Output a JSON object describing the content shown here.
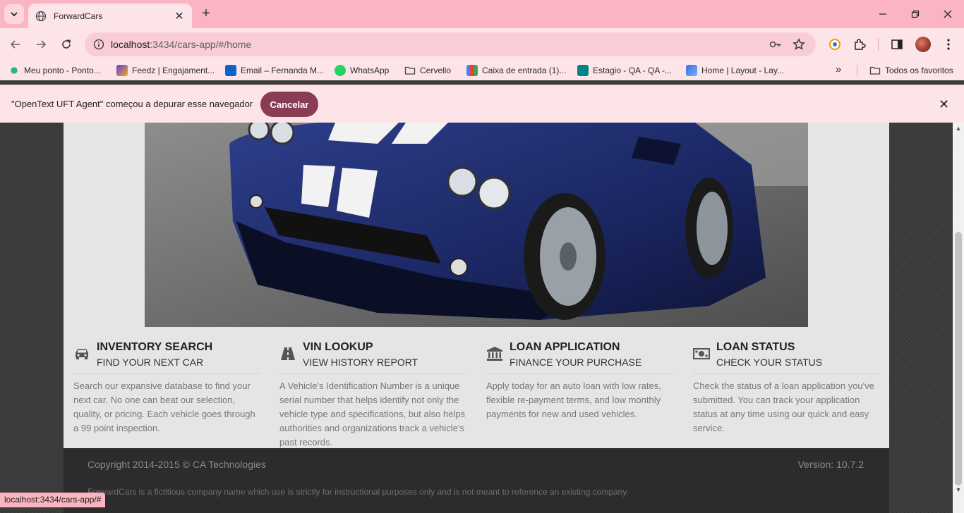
{
  "browser": {
    "tab_title": "ForwardCars",
    "url_host": "localhost",
    "url_path": ":3434/cars-app/#/home",
    "bookmarks": [
      {
        "label": "Meu ponto - Ponto...",
        "icon": "green-burst-icon",
        "color": "#2bb673"
      },
      {
        "label": "Feedz | Engajament...",
        "icon": "feedz-icon",
        "color": "#5b3fd6"
      },
      {
        "label": "Email – Fernanda M...",
        "icon": "outlook-icon",
        "color": "#0a64c9"
      },
      {
        "label": "WhatsApp",
        "icon": "whatsapp-icon",
        "color": "#25d366"
      },
      {
        "label": "Cervello",
        "icon": "folder-icon",
        "color": "#444444"
      },
      {
        "label": "Caixa de entrada (1)...",
        "icon": "gmail-icon",
        "color": "#ea4335"
      },
      {
        "label": "Estagio - QA - QA -...",
        "icon": "sharepoint-icon",
        "color": "#038387"
      },
      {
        "label": "Home | Layout - Lay...",
        "icon": "layout-icon",
        "color": "#3b6fe0"
      }
    ],
    "all_bookmarks_label": "Todos os favoritos",
    "infobar_message": "\"OpenText UFT Agent\" começou a depurar esse navegador",
    "infobar_cancel": "Cancelar",
    "status_url": "localhost:3434/cars-app/#"
  },
  "features": [
    {
      "icon": "car-icon",
      "title": "INVENTORY SEARCH",
      "subtitle": "FIND YOUR NEXT CAR",
      "description": "Search our expansive database to find your next car. No one can beat our selection, quality, or pricing. Each vehicle goes through a 99 point inspection."
    },
    {
      "icon": "road-icon",
      "title": "VIN LOOKUP",
      "subtitle": "VIEW HISTORY REPORT",
      "description": "A Vehicle's Identification Number is a unique serial number that helps identify not only the vehicle type and specifications, but also helps authorities and organizations track a vehicle's past records."
    },
    {
      "icon": "bank-icon",
      "title": "LOAN APPLICATION",
      "subtitle": "FINANCE YOUR PURCHASE",
      "description": "Apply today for an auto loan with low rates, flexible re-payment terms, and low monthly payments for new and used vehicles."
    },
    {
      "icon": "money-icon",
      "title": "LOAN STATUS",
      "subtitle": "CHECK YOUR STATUS",
      "description": "Check the status of a loan application you've submitted. You can track your application status at any time using our quick and easy service."
    }
  ],
  "footer": {
    "copyright": "Copyright 2014-2015 © CA Technologies",
    "version": "Version: 10.7.2",
    "disclaimer": "ForwardCars is a fictitious company name which use is strictly for instructional purposes only and is not meant to reference an existing company."
  }
}
